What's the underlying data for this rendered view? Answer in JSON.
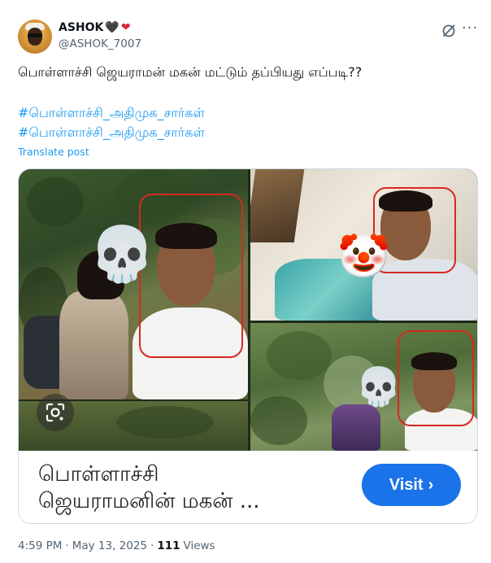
{
  "author": {
    "display_name": "ASHOK",
    "name_emojis": [
      "🖤",
      "❤"
    ],
    "handle": "@ASHOK_7007"
  },
  "tweet": {
    "text": "பொள்ளாச்சி ஜெயராமன் மகன் மட்டும் தப்பியது எப்படி??",
    "hashtags": [
      "#பொள்ளாச்சி_அதிமுக_சார்கள்",
      "#பொள்ளாச்சி_அதிமுக_சார்கள்"
    ],
    "translate_label": "Translate post"
  },
  "card": {
    "title_line1": "பொள்ளாச்சி",
    "title_line2": "ஜெயராமனின் மகன் ...",
    "visit_label": "Visit",
    "visit_chevron": "›",
    "stickers": [
      "💀",
      "🤡",
      "💀"
    ]
  },
  "meta": {
    "time": "4:59 PM",
    "separator1": "·",
    "date": "May 13, 2025",
    "separator2": "·",
    "views_count": "111",
    "views_label": "Views"
  },
  "icons": {
    "grok": "grok-icon",
    "more": "more-icon",
    "lens": "google-lens-icon"
  },
  "colors": {
    "link": "#1d9bf0",
    "secondary": "#536471",
    "visit_button": "#1a73e8",
    "highlight_box": "#d8281f"
  }
}
